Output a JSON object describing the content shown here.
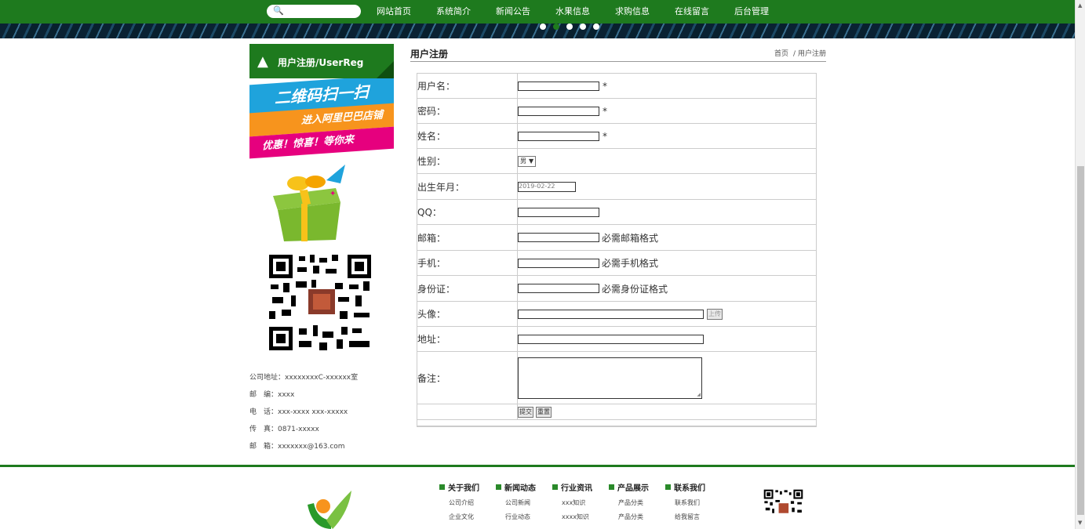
{
  "nav": {
    "search_placeholder": "",
    "items": [
      "网站首页",
      "系统简介",
      "新闻公告",
      "水果信息",
      "求购信息",
      "在线留言",
      "后台管理"
    ]
  },
  "banner": {
    "slides": 5,
    "active_index": 1
  },
  "sidebar": {
    "title": "用户注册/UserReg",
    "promo_line1": "二维码扫一扫",
    "promo_line2": "进入阿里巴巴店铺",
    "promo_line3": "优惠！惊喜！等你来",
    "contact": [
      "公司地址：xxxxxxxxC-xxxxxx室",
      "邮　编：xxxx",
      "电　话：xxx-xxxx xxx-xxxxx",
      "传　真：0871-xxxxx",
      "邮　箱：xxxxxxx@163.com"
    ]
  },
  "main": {
    "title": "用户注册",
    "breadcrumb_home": "首页",
    "breadcrumb_sep": "/",
    "breadcrumb_current": "用户注册"
  },
  "form": {
    "username_label": "用户名：",
    "password_label": "密码：",
    "name_label": "姓名：",
    "gender_label": "性别：",
    "gender_value": "男",
    "birth_label": "出生年月：",
    "birth_value": "2019-02-22",
    "qq_label": "QQ：",
    "email_label": "邮箱：",
    "email_hint": "必需邮箱格式",
    "phone_label": "手机：",
    "phone_hint": "必需手机格式",
    "id_label": "身份证：",
    "id_hint": "必需身份证格式",
    "avatar_label": "头像：",
    "upload_label": "上传",
    "address_label": "地址：",
    "remark_label": "备注：",
    "required_mark": "*",
    "submit_label": "提交",
    "reset_label": "重置"
  },
  "footer": {
    "columns": [
      {
        "title": "关于我们",
        "links": [
          "公司介绍",
          "企业文化"
        ]
      },
      {
        "title": "新闻动态",
        "links": [
          "公司新闻",
          "行业动态"
        ]
      },
      {
        "title": "行业资讯",
        "links": [
          "xxx知识",
          "xxxx知识"
        ]
      },
      {
        "title": "产品展示",
        "links": [
          "产品分类",
          "产品分类"
        ]
      },
      {
        "title": "联系我们",
        "links": [
          "联系我们",
          "给我留言"
        ]
      }
    ]
  },
  "colors": {
    "brand_green": "#1e7a1e",
    "border": "#cccccc"
  }
}
